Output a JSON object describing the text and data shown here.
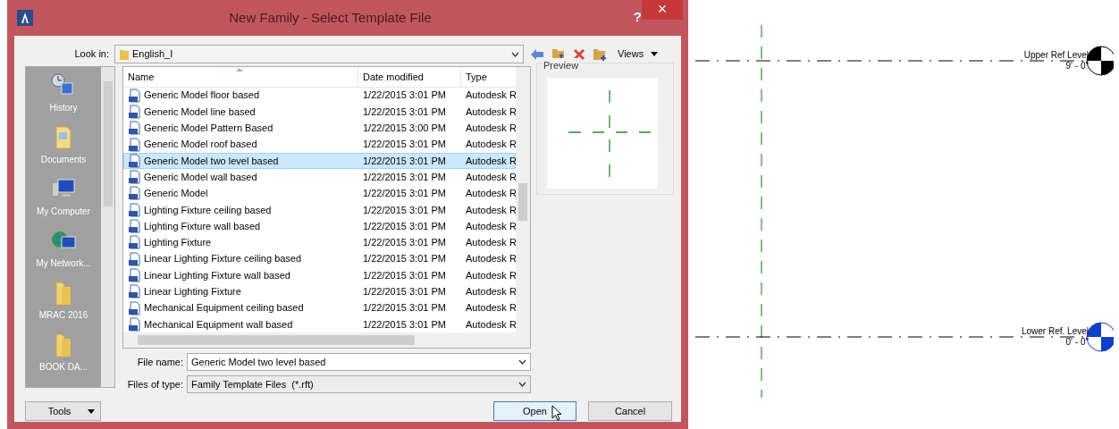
{
  "window": {
    "title": "New Family - Select Template File",
    "help": "?",
    "close": "×"
  },
  "look_in": {
    "label": "Look in:",
    "value": "English_I"
  },
  "toolbar": {
    "views": "Views"
  },
  "places": [
    {
      "label": "History",
      "kind": "history"
    },
    {
      "label": "Documents",
      "kind": "documents"
    },
    {
      "label": "My Computer",
      "kind": "computer"
    },
    {
      "label": "My Network...",
      "kind": "network"
    },
    {
      "label": "MRAC 2016",
      "kind": "folder"
    },
    {
      "label": "BOOK DA...",
      "kind": "folder"
    }
  ],
  "file_list": {
    "columns": [
      "Name",
      "Date modified",
      "Type"
    ],
    "rows": [
      {
        "name": "Generic Model floor based",
        "date": "1/22/2015 3:01 PM",
        "type": "Autodesk R",
        "selected": false
      },
      {
        "name": "Generic Model line based",
        "date": "1/22/2015 3:01 PM",
        "type": "Autodesk R",
        "selected": false
      },
      {
        "name": "Generic Model Pattern Based",
        "date": "1/22/2015 3:00 PM",
        "type": "Autodesk R",
        "selected": false
      },
      {
        "name": "Generic Model roof based",
        "date": "1/22/2015 3:01 PM",
        "type": "Autodesk R",
        "selected": false
      },
      {
        "name": "Generic Model two level based",
        "date": "1/22/2015 3:01 PM",
        "type": "Autodesk R",
        "selected": true
      },
      {
        "name": "Generic Model wall based",
        "date": "1/22/2015 3:01 PM",
        "type": "Autodesk R",
        "selected": false
      },
      {
        "name": "Generic Model",
        "date": "1/22/2015 3:01 PM",
        "type": "Autodesk R",
        "selected": false
      },
      {
        "name": "Lighting Fixture ceiling based",
        "date": "1/22/2015 3:01 PM",
        "type": "Autodesk R",
        "selected": false
      },
      {
        "name": "Lighting Fixture wall based",
        "date": "1/22/2015 3:01 PM",
        "type": "Autodesk R",
        "selected": false
      },
      {
        "name": "Lighting Fixture",
        "date": "1/22/2015 3:01 PM",
        "type": "Autodesk R",
        "selected": false
      },
      {
        "name": "Linear Lighting Fixture ceiling based",
        "date": "1/22/2015 3:01 PM",
        "type": "Autodesk R",
        "selected": false
      },
      {
        "name": "Linear Lighting Fixture wall based",
        "date": "1/22/2015 3:01 PM",
        "type": "Autodesk R",
        "selected": false
      },
      {
        "name": "Linear Lighting Fixture",
        "date": "1/22/2015 3:01 PM",
        "type": "Autodesk R",
        "selected": false
      },
      {
        "name": "Mechanical Equipment ceiling based",
        "date": "1/22/2015 3:01 PM",
        "type": "Autodesk R",
        "selected": false
      },
      {
        "name": "Mechanical Equipment wall based",
        "date": "1/22/2015 3:01 PM",
        "type": "Autodesk R",
        "selected": false
      }
    ]
  },
  "preview": {
    "label": "Preview"
  },
  "file_name": {
    "label": "File name:",
    "value": "Generic Model two level based"
  },
  "file_type": {
    "label": "Files of type:",
    "value": "Family Template Files  (*.rft)"
  },
  "buttons": {
    "tools": "Tools",
    "open": "Open",
    "cancel": "Cancel"
  },
  "levels": [
    {
      "name": "Upper Ref Level",
      "elevation": "9' - 0\"",
      "kind": "upper"
    },
    {
      "name": "Lower Ref. Level",
      "elevation": "0' - 0\"",
      "kind": "lower"
    }
  ]
}
